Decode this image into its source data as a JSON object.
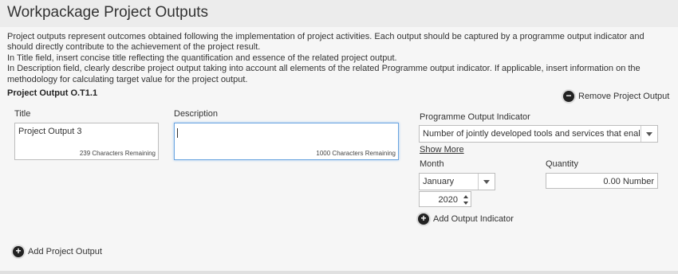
{
  "page": {
    "title": "Workpackage Project Outputs"
  },
  "intro": {
    "line1": "Project outputs represent outcomes obtained following the implementation of project activities. Each output should be captured by a programme output indicator and should directly contribute to the achievement of the project result.",
    "line2": "In Title field, insert concise title reflecting the quantification and essence of the related project output.",
    "line3": "In Description field, clearly describe project output taking into account all elements of the related Programme output indicator. If applicable, insert information on the methodology for calculating target value for the project output."
  },
  "output": {
    "heading": "Project Output O.T1.1",
    "remove_label": "Remove Project Output",
    "title_label": "Title",
    "title_value": "Project Output 3",
    "title_remaining": "239 Characters Remaining",
    "description_label": "Description",
    "description_value": "",
    "description_remaining": "1000 Characters Remaining",
    "indicator_label": "Programme Output Indicator",
    "indicator_value": "Number of jointly developed tools and services that enabe be",
    "show_more": "Show More",
    "month_label": "Month",
    "month_value": "January",
    "year_value": "2020",
    "quantity_label": "Quantity",
    "quantity_value": "0.00 Number",
    "add_indicator_label": "Add Output Indicator"
  },
  "footer": {
    "add_output_label": "Add Project Output"
  },
  "icons": {
    "remove": "minus-circle-icon",
    "add": "plus-circle-icon"
  }
}
